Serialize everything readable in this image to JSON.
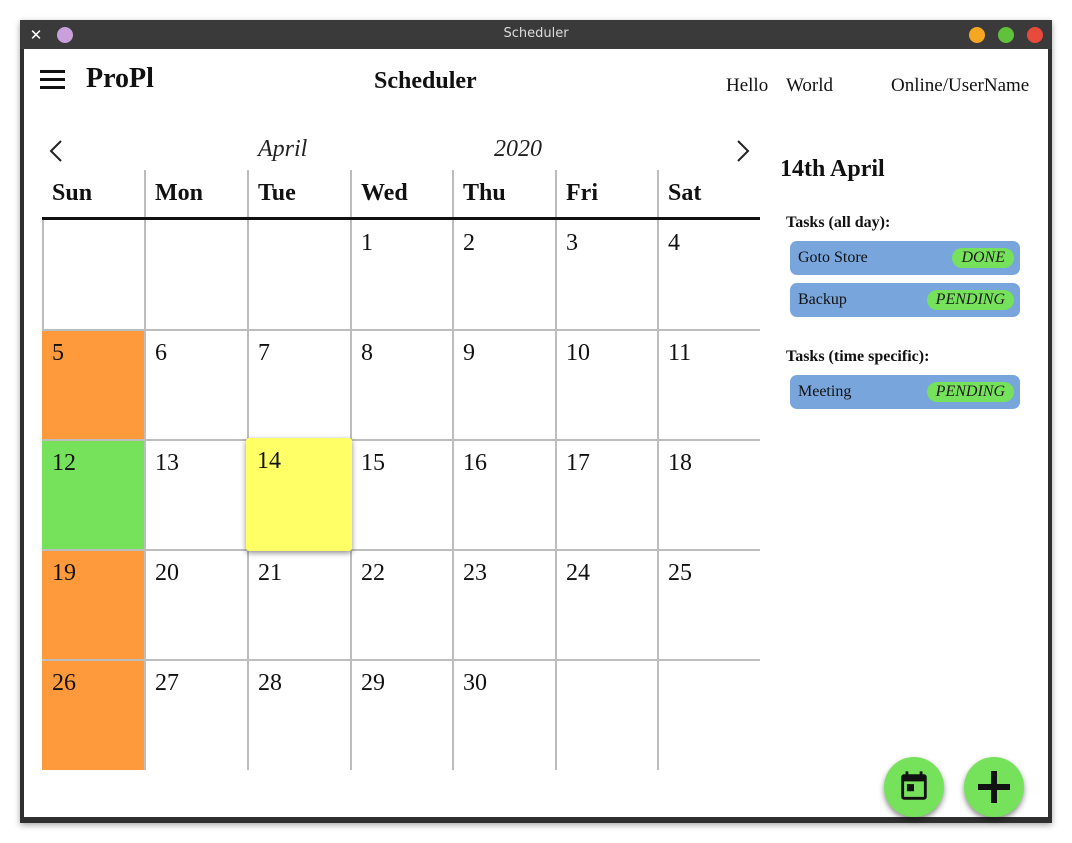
{
  "window": {
    "title": "Scheduler"
  },
  "header": {
    "app_name": "ProPl",
    "page_title": "Scheduler",
    "hello": "Hello",
    "world": "World",
    "status": "Online/UserName"
  },
  "calendar": {
    "month": "April",
    "year": "2020",
    "weekdays": [
      "Sun",
      "Mon",
      "Tue",
      "Wed",
      "Thu",
      "Fri",
      "Sat"
    ],
    "weeks": [
      [
        "",
        "",
        "",
        "1",
        "2",
        "3",
        "4"
      ],
      [
        "5",
        "6",
        "7",
        "8",
        "9",
        "10",
        "11"
      ],
      [
        "12",
        "13",
        "14",
        "15",
        "16",
        "17",
        "18"
      ],
      [
        "19",
        "20",
        "21",
        "22",
        "23",
        "24",
        "25"
      ],
      [
        "26",
        "27",
        "28",
        "29",
        "30",
        "",
        ""
      ]
    ],
    "selected_day": "14",
    "day_colors": {
      "5": "#ff9a3c",
      "12": "#76e25b",
      "19": "#ff9a3c",
      "26": "#ff9a3c"
    }
  },
  "sidebar": {
    "date": "14th April",
    "all_day_title": "Tasks (all day):",
    "all_day_tasks": [
      {
        "name": "Goto Store",
        "status": "DONE"
      },
      {
        "name": "Backup",
        "status": "PENDING"
      }
    ],
    "timed_title": "Tasks (time specific):",
    "timed_tasks": [
      {
        "name": "Meeting",
        "status": "PENDING"
      }
    ]
  },
  "colors": {
    "selected": "#ffff66",
    "orange": "#ff9a3c",
    "green": "#76e25b",
    "task_bg": "#78a5dc",
    "minimize": "#f5a623",
    "maximize": "#5fc23a",
    "close": "#e84b3c",
    "pin": "#c9a0dc"
  },
  "icons": {
    "menu": "hamburger-menu-icon",
    "prev": "chevron-left-icon",
    "next": "chevron-right-icon",
    "calendar_fab": "calendar-event-icon",
    "add_fab": "plus-icon"
  }
}
